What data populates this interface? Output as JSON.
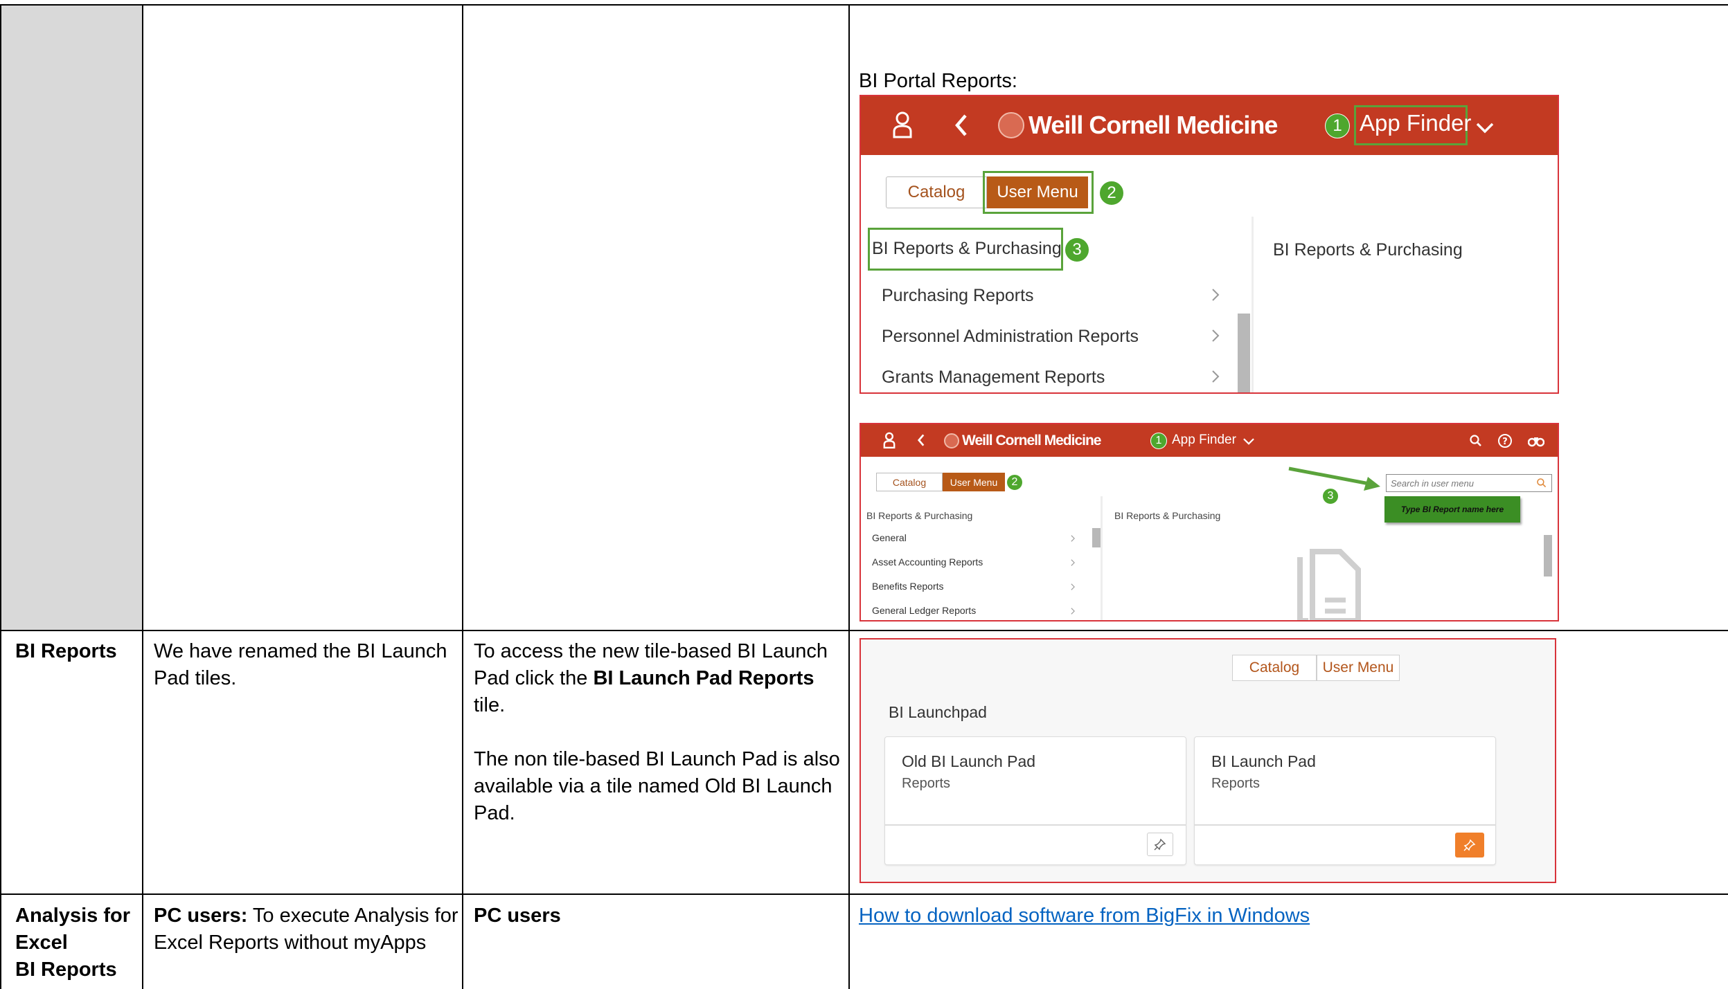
{
  "table": {
    "row1": {
      "screenshot_caption": "BI Portal Reports:"
    },
    "row2": {
      "col1": "BI Reports",
      "col2": "We have renamed the BI Launch Pad tiles.",
      "col3_p1_pre": "To access the new tile-based BI Launch Pad click the ",
      "col3_p1_bold": "BI Launch Pad Reports",
      "col3_p1_post": " tile.",
      "col3_p2": "The non tile-based BI Launch Pad is also available via a tile named Old BI Launch Pad."
    },
    "row3": {
      "col1_line1": "Analysis for",
      "col1_line2": "Excel",
      "col1_line3": "BI Reports",
      "col2_bold": "PC users:",
      "col2_rest": " To execute Analysis for Excel Reports without myApps",
      "col3_bold": "PC users",
      "col4_link": "How to download software from BigFix in Windows"
    }
  },
  "shot1": {
    "brand": "Weill Cornell Medicine",
    "app_finder": "App Finder",
    "badge1": "1",
    "badge2": "2",
    "badge3": "3",
    "tab_catalog": "Catalog",
    "tab_user_menu": "User Menu",
    "group_title": "BI Reports & Purchasing",
    "right_pane_title": "BI Reports & Purchasing",
    "items": [
      "Purchasing Reports",
      "Personnel Administration Reports",
      "Grants Management Reports"
    ]
  },
  "shot2": {
    "brand": "Weill Cornell Medicine",
    "app_finder": "App Finder",
    "badge1": "1",
    "badge2": "2",
    "badge3": "3",
    "tab_catalog": "Catalog",
    "tab_user_menu": "User Menu",
    "search_placeholder": "Search in user menu",
    "callout_text": "Type BI Report name here",
    "group_title": "BI Reports & Purchasing",
    "right_pane_title": "BI Reports & Purchasing",
    "items": [
      "General",
      "Asset Accounting Reports",
      "Benefits Reports",
      "General Ledger Reports"
    ]
  },
  "shot3": {
    "tab_catalog": "Catalog",
    "tab_user_menu": "User Menu",
    "group_title": "BI Launchpad",
    "tiles": [
      {
        "title": "Old BI Launch Pad",
        "subtitle": "Reports"
      },
      {
        "title": "BI Launch Pad",
        "subtitle": "Reports"
      }
    ]
  },
  "colors": {
    "shell_red": "#c33a22",
    "highlight_green": "#5aa33b",
    "badge_green": "#4ea72e",
    "user_menu_brown": "#b85a17",
    "frame_red": "#d8333a",
    "pin_orange": "#f07f2a",
    "link_blue": "#0563c1",
    "shade_gray": "#d9d9d9"
  },
  "icons": [
    "person-icon",
    "back-icon",
    "chevron-down-icon",
    "chevron-right-icon",
    "search-icon",
    "help-icon",
    "binoculars-icon",
    "pin-icon",
    "document-icon",
    "arrow-icon",
    "seal-icon"
  ]
}
